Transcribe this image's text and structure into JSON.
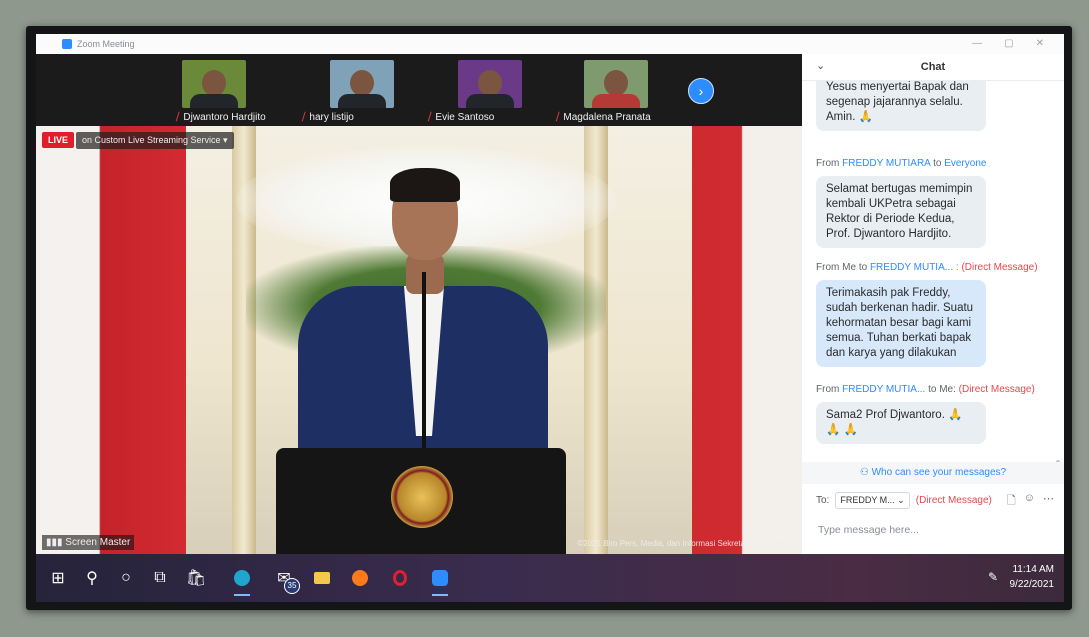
{
  "window": {
    "title": "Zoom Meeting",
    "controls": [
      "—",
      "▢",
      "✕"
    ]
  },
  "thumbnails": [
    {
      "name": "Djwantoro Hardjito",
      "bg": "#6a8a3a"
    },
    {
      "name": "hary listijo",
      "bg": "#7fa2b8"
    },
    {
      "name": "Evie Santoso",
      "bg": "#6a3a88"
    },
    {
      "name": "Magdalena Pranata",
      "bg": "#7f9a6d"
    }
  ],
  "next_icon": "›",
  "video": {
    "live_label": "LIVE",
    "live_status": "on Custom Live Streaming Service ▾",
    "screen_master": "Screen Master",
    "credit": "©2021 Biro Pers, Media, dan Informasi Sekretariat Presiden"
  },
  "chat": {
    "title": "Chat",
    "collapse_icon": "⌄",
    "messages": [
      {
        "text": "Yesus menyertai Bapak dan segenap jajarannya selalu. Amin. 🙏"
      },
      {
        "from": "FREDDY MUTIARA",
        "to": "Everyone",
        "text": "Selamat bertugas memimpin kembali UKPetra sebagai Rektor di Periode Kedua, Prof. Djwantoro Hardjito."
      },
      {
        "from": "Me",
        "to": "FREDDY MUTIA... :",
        "dm": "(Direct Message)",
        "text": "Terimakasih pak Freddy, sudah berkenan hadir. Suatu kehormatan besar bagi kami semua. Tuhan berkati bapak dan karya yang dilakukan"
      },
      {
        "from": "FREDDY MUTIA...",
        "to": "Me:",
        "dm": "(Direct Message)",
        "text": "Sama2 Prof Djwantoro. 🙏🙏 🙏"
      }
    ],
    "from_word": "From",
    "to_word": "to",
    "who_can_see": "Who can see your messages?",
    "to_label": "To:",
    "to_value": "FREDDY M... ⌄",
    "to_dm": "(Direct Message)",
    "input_placeholder": "Type message here...",
    "tool_icons": [
      "🗋",
      "☺",
      "⋯"
    ]
  },
  "taskbar": {
    "items": [
      "start",
      "search",
      "cortana",
      "task-view",
      "store",
      "edge",
      "mail",
      "explorer",
      "firefox",
      "opera",
      "zoom"
    ],
    "mail_badge": "35",
    "time": "11:14 AM",
    "date": "9/22/2021"
  }
}
